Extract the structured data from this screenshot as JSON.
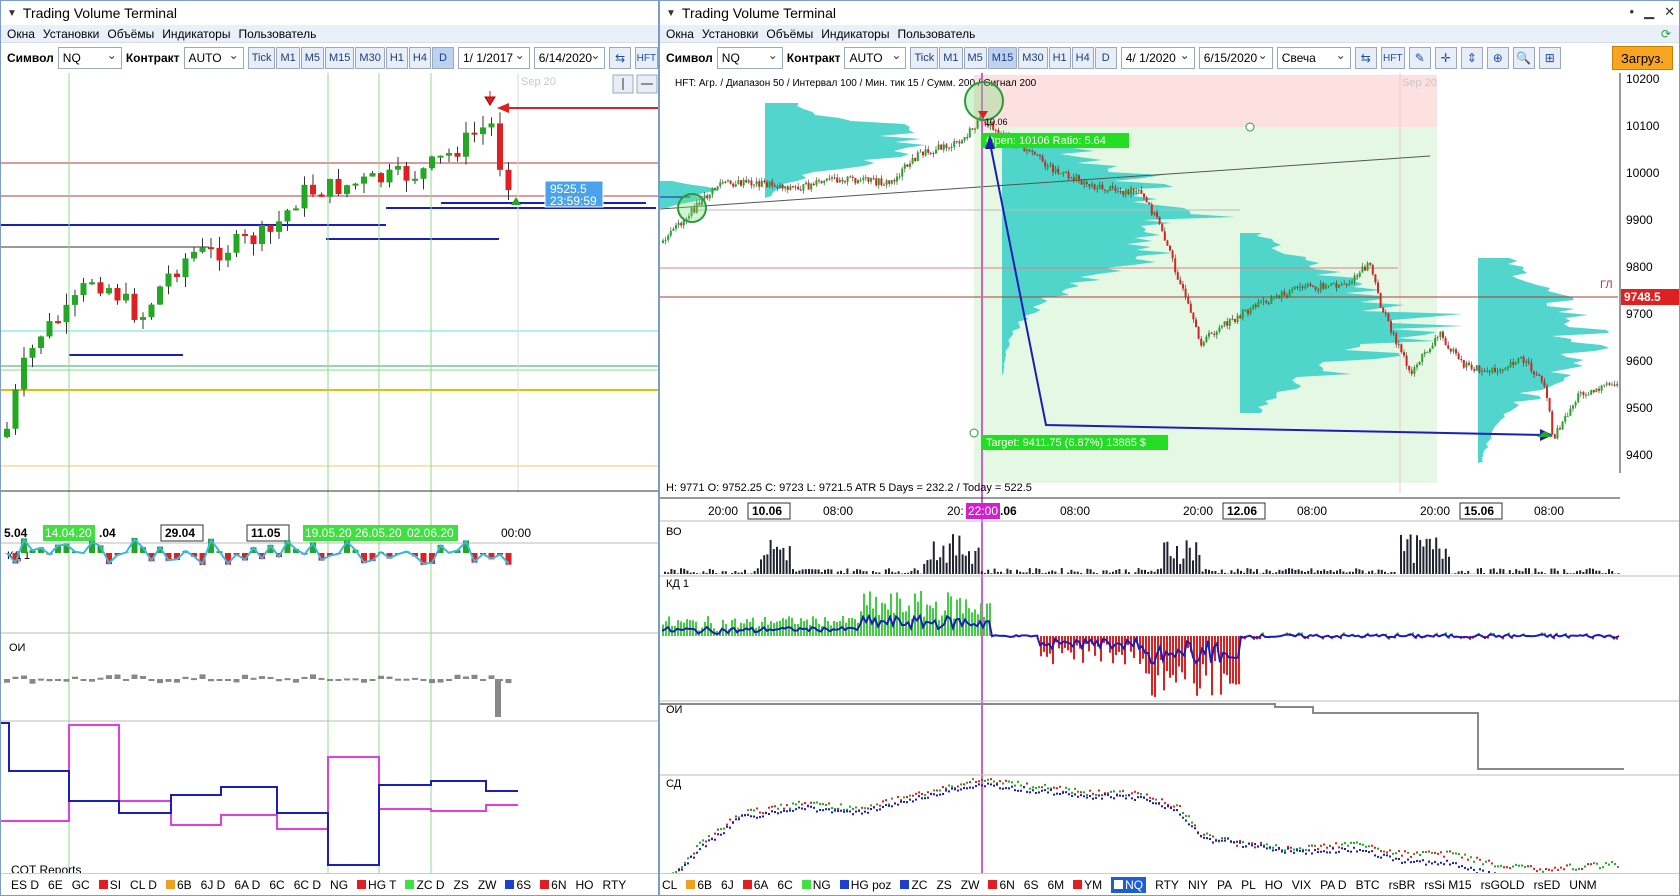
{
  "left": {
    "title": "Trading Volume Terminal",
    "menu": [
      "Окна",
      "Установки",
      "Объёмы",
      "Индикаторы",
      "Пользователь"
    ],
    "symbol_label": "Символ",
    "symbol_value": "NQ",
    "contract_label": "Контракт",
    "contract_value": "AUTO",
    "timeframes": [
      "Tick",
      "M1",
      "M5",
      "M15",
      "M30",
      "H1",
      "H4",
      "D"
    ],
    "active_tf": "D",
    "date_from": "1/ 1/2017",
    "date_to": "6/14/2020",
    "hft_label": "HFT",
    "watermark": "Sep 20",
    "price_box": "9525.5",
    "time_box": "23:59:59",
    "date_labels": [
      "5.04",
      "14.04.20",
      ".04",
      "29.04",
      "11.05",
      "19.05.20",
      "26.05.20",
      "02.06.20",
      "00:00"
    ],
    "panel_kd": "КД 1",
    "panel_oi": "ОИ",
    "cot_label": "COT Reports",
    "bottom_symbols": [
      {
        "label": "ES D",
        "color": ""
      },
      {
        "label": "6E",
        "color": ""
      },
      {
        "label": "GC",
        "color": ""
      },
      {
        "label": "SI",
        "color": "#e02020"
      },
      {
        "label": "CL D",
        "color": ""
      },
      {
        "label": "6B",
        "color": "#f0a020"
      },
      {
        "label": "6J D",
        "color": ""
      },
      {
        "label": "6A D",
        "color": ""
      },
      {
        "label": "6C",
        "color": ""
      },
      {
        "label": "6C D",
        "color": ""
      },
      {
        "label": "NG",
        "color": ""
      },
      {
        "label": "HG T",
        "color": "#e02020"
      },
      {
        "label": "ZC D",
        "color": "#40e040"
      },
      {
        "label": "ZS",
        "color": ""
      },
      {
        "label": "ZW",
        "color": ""
      },
      {
        "label": "6S",
        "color": "#1d3fd0"
      },
      {
        "label": "6N",
        "color": "#e02020"
      },
      {
        "label": "HO",
        "color": ""
      },
      {
        "label": "RTY",
        "color": ""
      }
    ]
  },
  "right": {
    "title": "Trading Volume Terminal",
    "menu": [
      "Окна",
      "Установки",
      "Объёмы",
      "Индикаторы",
      "Пользователь"
    ],
    "symbol_label": "Символ",
    "symbol_value": "NQ",
    "contract_label": "Контракт",
    "contract_value": "AUTO",
    "timeframes": [
      "Tick",
      "M1",
      "M5",
      "M15",
      "M30",
      "H1",
      "H4",
      "D"
    ],
    "active_tf": "M15",
    "date_from": "4/ 1/2020",
    "date_to": "6/15/2020",
    "chart_type": "Свеча",
    "hft_label": "HFT",
    "load_button": "Загруз.",
    "info_line": "HFT: Агр. / Диапазон 50 / Интервал 100 / Мин. тик 15 / Сумм. 200 / Сигнал 200",
    "open_label": "Open: 10106  Ratio: 5.64",
    "target_label": "Target: 9411.75 (6.87%) 13885 $",
    "small_label": "10.06",
    "watermark": "Sep 20",
    "gl_label": "ГЛ",
    "price_tag": "9748.5",
    "price_axis": [
      "10200",
      "10100",
      "10000",
      "9900",
      "9800",
      "9700",
      "9600",
      "9500",
      "9400"
    ],
    "ohlc": "H: 9771   O: 9752.25   C: 9723   L: 9721.5   ATR 5 Days = 232.2 / Today = 522.5",
    "time_labels": [
      "20:00",
      "10.06",
      "08:00",
      "20:",
      "22:00",
      ".06",
      "08:00",
      "20:00",
      "12.06",
      "08:00",
      "20:00",
      "15.06",
      "08:00"
    ],
    "panel_vo": "ВО",
    "panel_kd": "КД 1",
    "panel_oi": "ОИ",
    "panel_sd": "СД",
    "bottom_symbols": [
      {
        "label": "CL",
        "color": ""
      },
      {
        "label": "6B",
        "color": "#f0a020"
      },
      {
        "label": "6J",
        "color": ""
      },
      {
        "label": "6A",
        "color": "#e02020"
      },
      {
        "label": "6C",
        "color": ""
      },
      {
        "label": "NG",
        "color": "#40e040"
      },
      {
        "label": "HG poz",
        "color": "#1d3fd0"
      },
      {
        "label": "ZC",
        "color": "#1d3fd0"
      },
      {
        "label": "ZS",
        "color": ""
      },
      {
        "label": "ZW",
        "color": ""
      },
      {
        "label": "6N",
        "color": "#e02020"
      },
      {
        "label": "6S",
        "color": ""
      },
      {
        "label": "6M",
        "color": ""
      },
      {
        "label": "YM",
        "color": "#e02020"
      },
      {
        "label": "NQ",
        "color": "#1d3fd0",
        "active": true
      },
      {
        "label": "RTY",
        "color": ""
      },
      {
        "label": "NIY",
        "color": ""
      },
      {
        "label": "PA",
        "color": ""
      },
      {
        "label": "PL",
        "color": ""
      },
      {
        "label": "HO",
        "color": ""
      },
      {
        "label": "VIX",
        "color": ""
      },
      {
        "label": "PA D",
        "color": ""
      },
      {
        "label": "BTC",
        "color": ""
      },
      {
        "label": "rsBR",
        "color": ""
      },
      {
        "label": "rsSi M15",
        "color": ""
      },
      {
        "label": "rsGOLD",
        "color": ""
      },
      {
        "label": "rsED",
        "color": ""
      },
      {
        "label": "UNM",
        "color": ""
      }
    ]
  },
  "colors": {
    "up": "#22a822",
    "down": "#e02020",
    "profile": "#3fd0c8",
    "accent": "#1c5ed6"
  }
}
